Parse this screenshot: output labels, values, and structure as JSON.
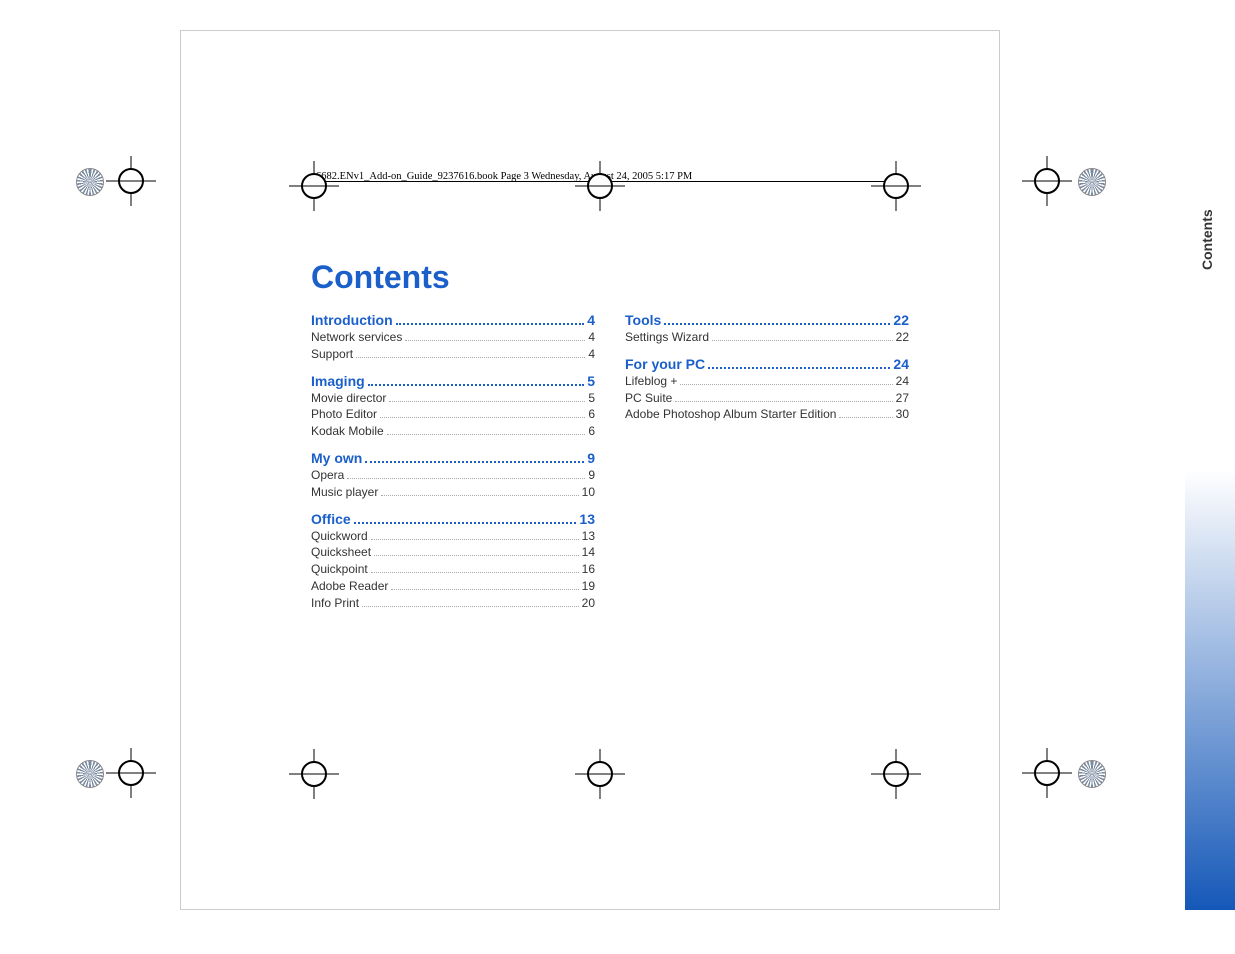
{
  "header": "6682.ENv1_Add-on_Guide_9237616.book  Page 3  Wednesday, August 24, 2005  5:17 PM",
  "title": "Contents",
  "sidebar_label": "Contents",
  "col1": [
    {
      "type": "section",
      "label": "Introduction",
      "page": "4"
    },
    {
      "type": "item",
      "label": "Network services",
      "page": "4"
    },
    {
      "type": "item",
      "label": "Support",
      "page": "4"
    },
    {
      "type": "section",
      "label": "Imaging",
      "page": "5"
    },
    {
      "type": "item",
      "label": "Movie director",
      "page": "5"
    },
    {
      "type": "item",
      "label": "Photo Editor",
      "page": "6"
    },
    {
      "type": "item",
      "label": "Kodak Mobile",
      "page": "6"
    },
    {
      "type": "section",
      "label": "My own",
      "page": "9"
    },
    {
      "type": "item",
      "label": "Opera",
      "page": "9"
    },
    {
      "type": "item",
      "label": "Music player",
      "page": "10"
    },
    {
      "type": "section",
      "label": "Office",
      "page": "13"
    },
    {
      "type": "item",
      "label": "Quickword",
      "page": "13"
    },
    {
      "type": "item",
      "label": "Quicksheet",
      "page": "14"
    },
    {
      "type": "item",
      "label": "Quickpoint",
      "page": "16"
    },
    {
      "type": "item",
      "label": "Adobe Reader",
      "page": "19"
    },
    {
      "type": "item",
      "label": "Info Print",
      "page": "20"
    }
  ],
  "col2": [
    {
      "type": "section",
      "label": "Tools",
      "page": "22"
    },
    {
      "type": "item",
      "label": "Settings Wizard",
      "page": "22"
    },
    {
      "type": "section",
      "label": "For your PC",
      "page": "24"
    },
    {
      "type": "item",
      "label": "Lifeblog +",
      "page": "24"
    },
    {
      "type": "item",
      "label": "PC Suite",
      "page": "27"
    },
    {
      "type": "item",
      "label": "Adobe Photoshop Album Starter Edition",
      "page": "30"
    }
  ]
}
